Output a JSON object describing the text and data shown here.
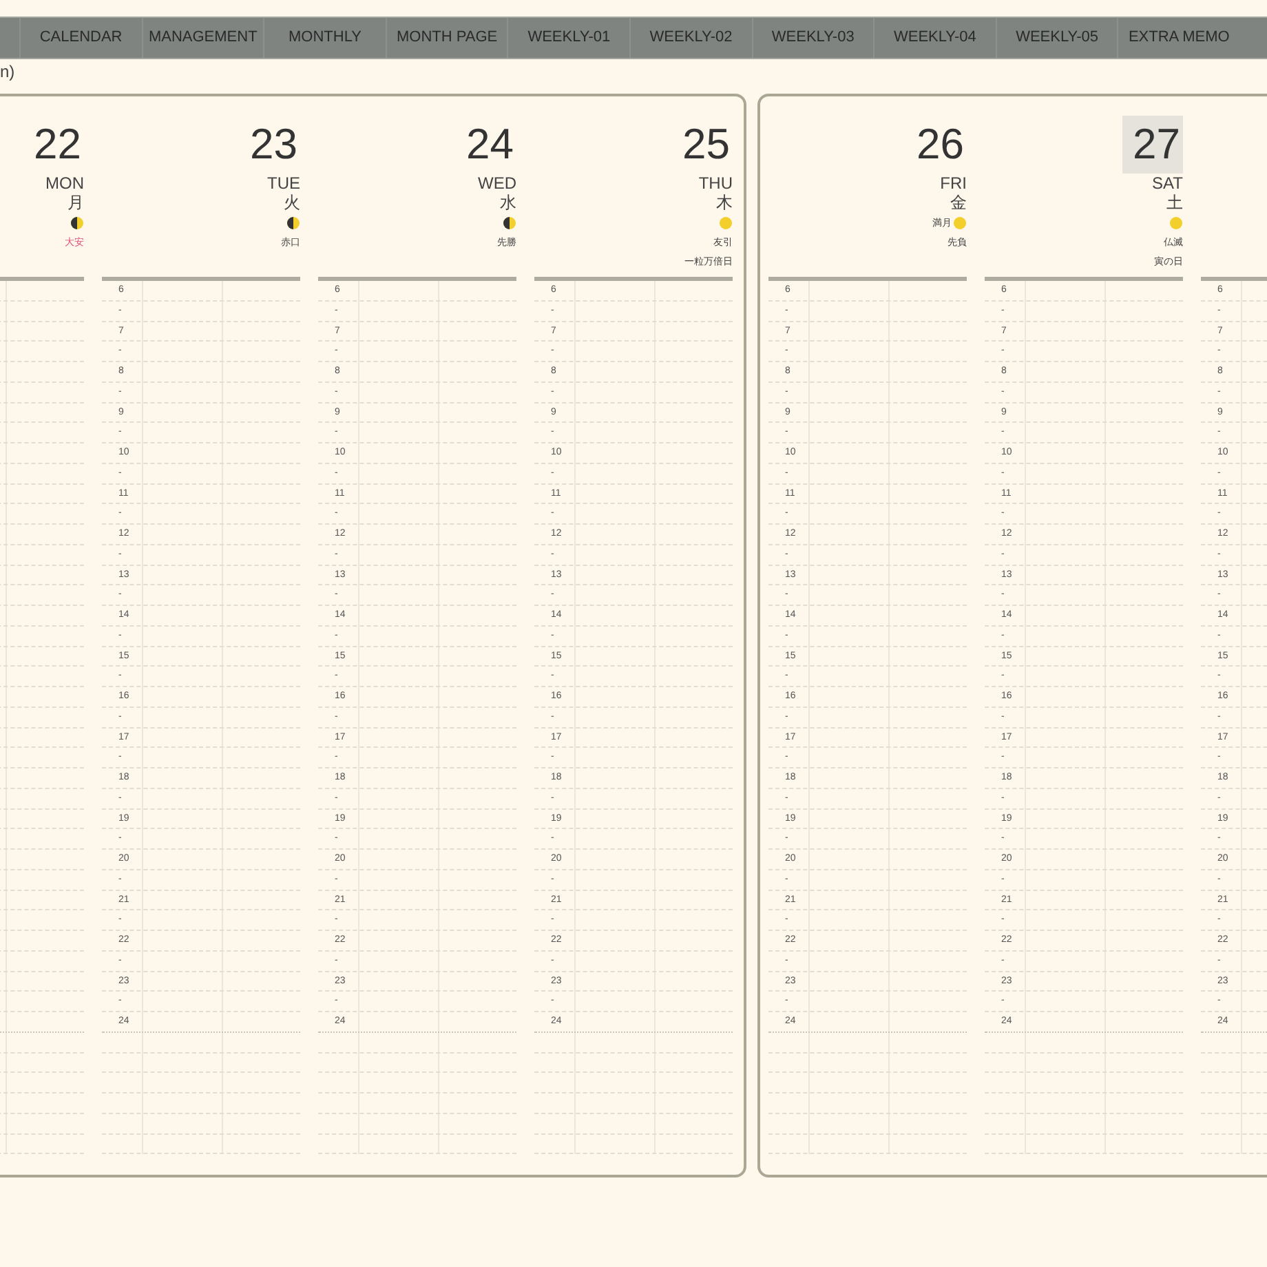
{
  "tabs": [
    {
      "label": "CALENDAR"
    },
    {
      "label": "MANAGEMENT"
    },
    {
      "label": "MONTHLY"
    },
    {
      "label": "MONTH PAGE"
    },
    {
      "label": "WEEKLY-01"
    },
    {
      "label": "WEEKLY-02"
    },
    {
      "label": "WEEKLY-03"
    },
    {
      "label": "WEEKLY-04"
    },
    {
      "label": "WEEKLY-05"
    },
    {
      "label": "EXTRA MEMO"
    }
  ],
  "heading": "n)",
  "pages": [
    {
      "days": [
        {
          "date": "22",
          "weekday": "MON",
          "kanji": "月",
          "moon": {
            "kind": "half"
          },
          "rokuyo": "大安",
          "lucky": true,
          "today": false
        },
        {
          "date": "23",
          "weekday": "TUE",
          "kanji": "火",
          "moon": {
            "kind": "half"
          },
          "rokuyo": "赤口",
          "lucky": false,
          "today": false,
          "hours": [
            "6",
            "-",
            "7",
            "-",
            "8",
            "-",
            "9",
            "-",
            "10",
            "-",
            "11",
            "-",
            "12",
            "-",
            "13",
            "-",
            "14",
            "-",
            "15",
            "-",
            "16",
            "-",
            "17",
            "-",
            "18",
            "-",
            "19",
            "-",
            "20",
            "-",
            "21",
            "-",
            "22",
            "-",
            "23",
            "-",
            "24"
          ]
        },
        {
          "date": "24",
          "weekday": "WED",
          "kanji": "水",
          "moon": {
            "kind": "half"
          },
          "rokuyo": "先勝",
          "lucky": false,
          "today": false,
          "hours": [
            "6",
            "-",
            "7",
            "-",
            "8",
            "-",
            "9",
            "-",
            "10",
            "-",
            "11",
            "-",
            "12",
            "-",
            "13",
            "-",
            "14",
            "-",
            "15",
            "-",
            "16",
            "-",
            "17",
            "-",
            "18",
            "-",
            "19",
            "-",
            "20",
            "-",
            "21",
            "-",
            "22",
            "-",
            "23",
            "-",
            "24"
          ]
        },
        {
          "date": "25",
          "weekday": "THU",
          "kanji": "木",
          "moon": {
            "kind": "full"
          },
          "rokuyo": "友引",
          "extra": "一粒万倍日",
          "lucky": false,
          "today": false,
          "hours": [
            "6",
            "-",
            "7",
            "-",
            "8",
            "-",
            "9",
            "-",
            "10",
            "-",
            "11",
            "-",
            "12",
            "-",
            "13",
            "-",
            "14",
            "-",
            "15",
            "-",
            "16",
            "-",
            "17",
            "-",
            "18",
            "-",
            "19",
            "-",
            "20",
            "-",
            "21",
            "-",
            "22",
            "-",
            "23",
            "-",
            "24"
          ]
        }
      ]
    },
    {
      "days": [
        {
          "date": "26",
          "weekday": "FRI",
          "kanji": "金",
          "moon": {
            "kind": "full"
          },
          "moon_label": "満月",
          "rokuyo": "先負",
          "lucky": false,
          "today": false,
          "hours": [
            "6",
            "-",
            "7",
            "-",
            "8",
            "-",
            "9",
            "-",
            "10",
            "-",
            "11",
            "-",
            "12",
            "-",
            "13",
            "-",
            "14",
            "-",
            "15",
            "-",
            "16",
            "-",
            "17",
            "-",
            "18",
            "-",
            "19",
            "-",
            "20",
            "-",
            "21",
            "-",
            "22",
            "-",
            "23",
            "-",
            "24"
          ]
        },
        {
          "date": "27",
          "weekday": "SAT",
          "kanji": "土",
          "moon": {
            "kind": "full"
          },
          "rokuyo": "仏滅",
          "extra": "寅の日",
          "lucky": false,
          "today": true,
          "hours": [
            "6",
            "-",
            "7",
            "-",
            "8",
            "-",
            "9",
            "-",
            "10",
            "-",
            "11",
            "-",
            "12",
            "-",
            "13",
            "-",
            "14",
            "-",
            "15",
            "-",
            "16",
            "-",
            "17",
            "-",
            "18",
            "-",
            "19",
            "-",
            "20",
            "-",
            "21",
            "-",
            "22",
            "-",
            "23",
            "-",
            "24"
          ]
        },
        {
          "hours": [
            "6",
            "-",
            "7",
            "-",
            "8",
            "-",
            "9",
            "-",
            "10",
            "-",
            "11",
            "-",
            "12",
            "-",
            "13",
            "-",
            "14",
            "-",
            "15",
            "-",
            "16",
            "-",
            "17",
            "-",
            "18",
            "-",
            "19",
            "-",
            "20",
            "-",
            "21",
            "-",
            "22",
            "-",
            "23",
            "-",
            "24"
          ]
        }
      ]
    }
  ]
}
